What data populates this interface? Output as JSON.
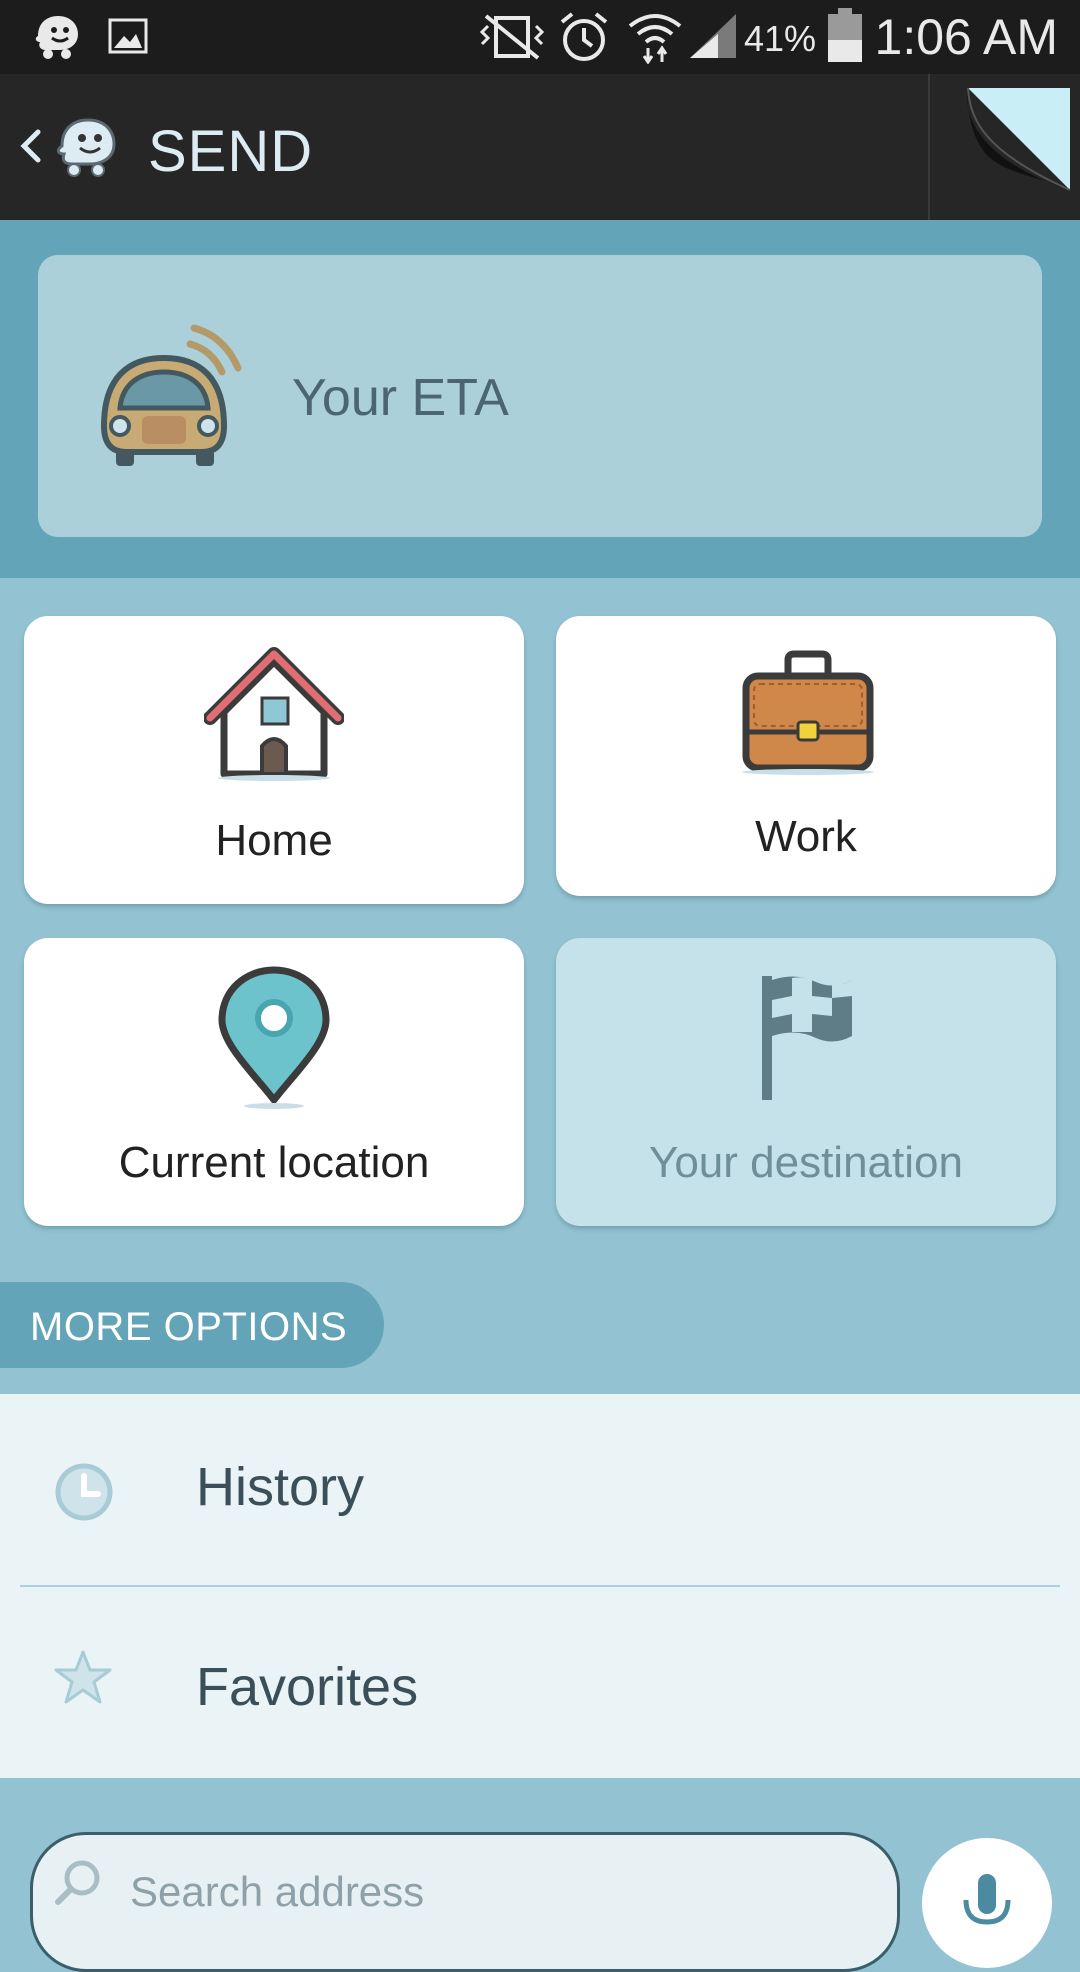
{
  "status_bar": {
    "battery": "41%",
    "time": "1:06 AM",
    "icons": [
      "waze-notification-icon",
      "image-notification-icon",
      "vibrate-icon",
      "alarm-icon",
      "wifi-icon",
      "signal-icon",
      "battery-icon"
    ]
  },
  "app_bar": {
    "title": "SEND",
    "back_icon": "back-arrow-icon",
    "logo": "waze-logo-icon"
  },
  "eta": {
    "label": "Your ETA",
    "icon": "car-icon"
  },
  "tiles": {
    "home": "Home",
    "work": "Work",
    "current_location": "Current location",
    "destination": "Your destination"
  },
  "more_options": {
    "label": "MORE OPTIONS"
  },
  "list": {
    "history": "History",
    "favorites": "Favorites"
  },
  "search": {
    "placeholder": "Search address"
  },
  "colors": {
    "accent": "#64a4b8",
    "background": "#93c3d2",
    "eta_card": "#acd0da",
    "list_bg": "#eaf3f6"
  }
}
